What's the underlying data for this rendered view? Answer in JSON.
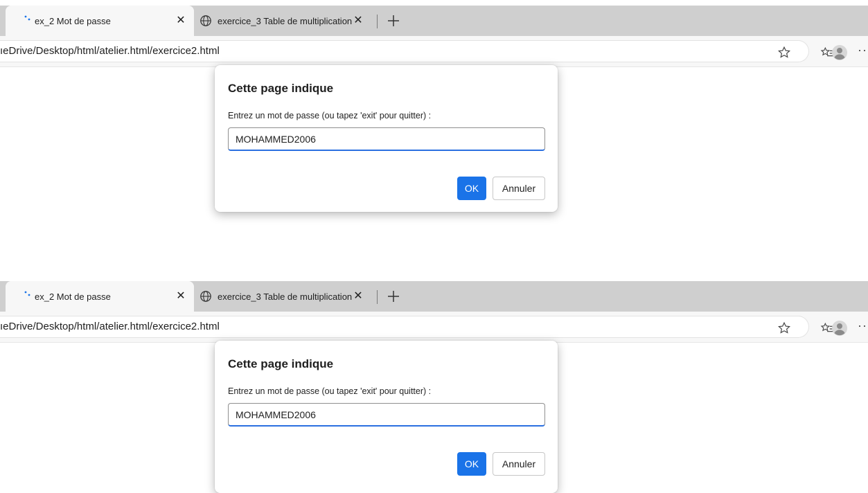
{
  "screenshots": [
    {
      "tabs": [
        {
          "title": "ex_2 Mot de passe",
          "close": "✕"
        },
        {
          "title": "exercice_3 Table de multiplication",
          "close": "✕"
        }
      ],
      "new_tab_label": "+",
      "url": "ıeDrive/Desktop/html/atelier.html/exercice2.html",
      "more_label": "···",
      "dialog": {
        "title": "Cette page indique",
        "message": "Entrez un mot de passe (ou tapez 'exit' pour quitter) :",
        "input_value": "MOHAMMED2006",
        "ok_label": "OK",
        "cancel_label": "Annuler"
      }
    },
    {
      "tabs": [
        {
          "title": "ex_2 Mot de passe",
          "close": "✕"
        },
        {
          "title": "exercice_3 Table de multiplication",
          "close": "✕"
        }
      ],
      "new_tab_label": "+",
      "url": "ıeDrive/Desktop/html/atelier.html/exercice2.html",
      "more_label": "···",
      "dialog": {
        "title": "Cette page indique",
        "message": "Entrez un mot de passe (ou tapez 'exit' pour quitter) :",
        "input_value": "MOHAMMED2006",
        "ok_label": "OK",
        "cancel_label": "Annuler"
      }
    }
  ],
  "colors": {
    "accent": "#1a73e8",
    "tabstrip": "#cfcfcf",
    "toolbar": "#f7f7f7"
  },
  "icons": [
    "spinner-icon",
    "close-icon",
    "globe-icon",
    "plus-icon",
    "star-icon",
    "favorites-icon",
    "avatar-icon",
    "more-icon"
  ]
}
